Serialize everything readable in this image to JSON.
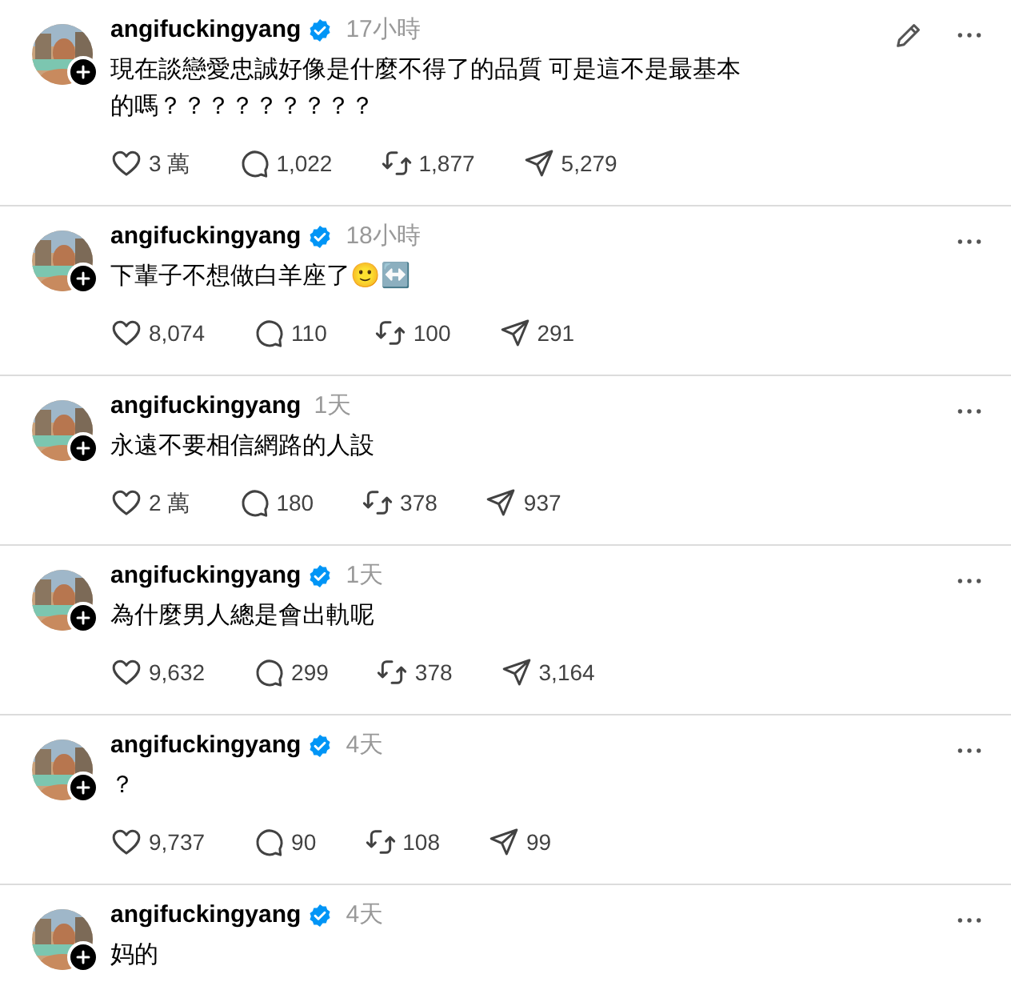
{
  "posts": [
    {
      "username": "angifuckingyang",
      "verified": true,
      "time": "17小時",
      "editable": true,
      "text": "現在談戀愛忠誠好像是什麼不得了的品質 可是這不是最基本的嗎？？？？？？？？？",
      "stats": {
        "likes": "3 萬",
        "replies": "1,022",
        "reposts": "1,877",
        "shares": "5,279"
      }
    },
    {
      "username": "angifuckingyang",
      "verified": true,
      "time": "18小時",
      "editable": false,
      "text": "下輩子不想做白羊座了🙂↔️",
      "stats": {
        "likes": "8,074",
        "replies": "110",
        "reposts": "100",
        "shares": "291"
      }
    },
    {
      "username": "angifuckingyang",
      "verified": false,
      "time": "1天",
      "editable": false,
      "text": "永遠不要相信網路的人設",
      "stats": {
        "likes": "2 萬",
        "replies": "180",
        "reposts": "378",
        "shares": "937"
      }
    },
    {
      "username": "angifuckingyang",
      "verified": true,
      "time": "1天",
      "editable": false,
      "text": "為什麼男人總是會出軌呢",
      "stats": {
        "likes": "9,632",
        "replies": "299",
        "reposts": "378",
        "shares": "3,164"
      }
    },
    {
      "username": "angifuckingyang",
      "verified": true,
      "time": "4天",
      "editable": false,
      "text": "？",
      "stats": {
        "likes": "9,737",
        "replies": "90",
        "reposts": "108",
        "shares": "99"
      }
    },
    {
      "username": "angifuckingyang",
      "verified": true,
      "time": "4天",
      "editable": false,
      "text": "妈的"
    }
  ]
}
